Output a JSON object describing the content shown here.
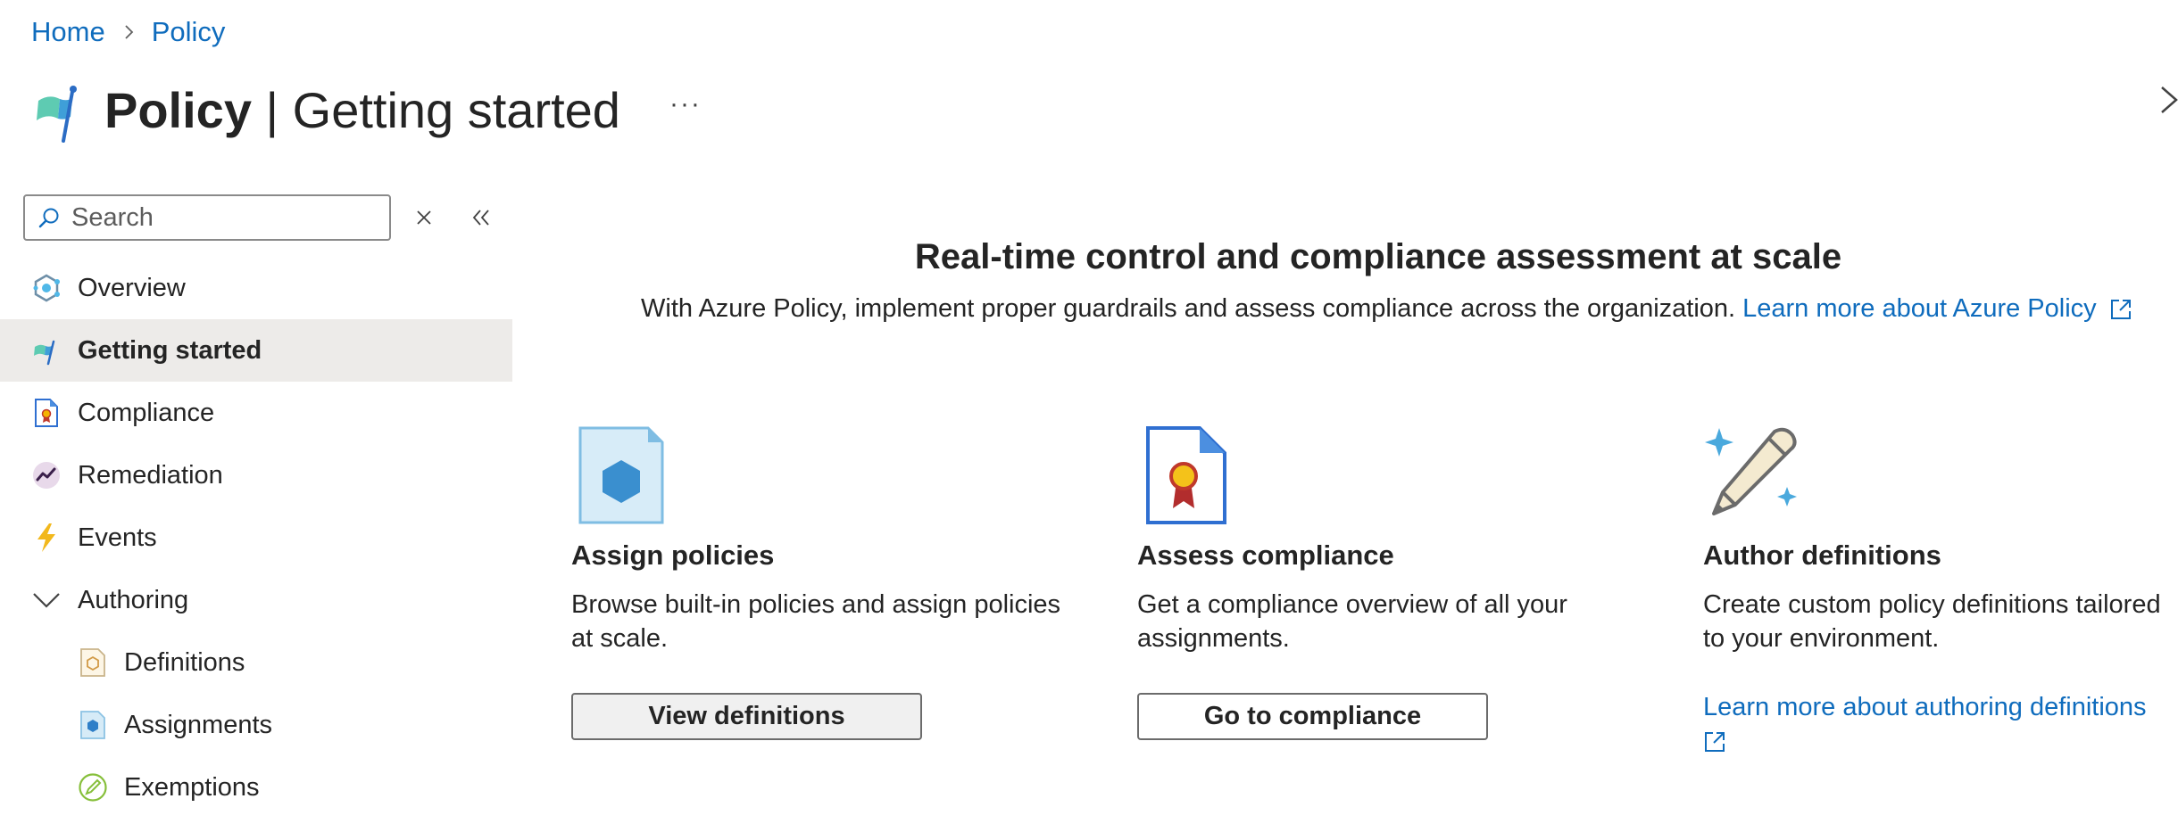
{
  "breadcrumb": {
    "home": "Home",
    "policy": "Policy"
  },
  "header": {
    "title_bold": "Policy",
    "title_separator": " | ",
    "title_rest": "Getting started",
    "more": "···"
  },
  "sidebar": {
    "search_placeholder": "Search",
    "items": [
      {
        "label": "Overview",
        "icon": "overview-icon"
      },
      {
        "label": "Getting started",
        "icon": "getting-started-icon",
        "active": true
      },
      {
        "label": "Compliance",
        "icon": "compliance-icon"
      },
      {
        "label": "Remediation",
        "icon": "remediation-icon"
      },
      {
        "label": "Events",
        "icon": "events-icon"
      },
      {
        "label": "Authoring",
        "icon": "chevron-down-icon",
        "expanded": true
      },
      {
        "label": "Definitions",
        "icon": "definitions-icon"
      },
      {
        "label": "Assignments",
        "icon": "assignments-icon"
      },
      {
        "label": "Exemptions",
        "icon": "exemptions-icon"
      }
    ]
  },
  "hero": {
    "title": "Real-time control and compliance assessment at scale",
    "subtitle": "With Azure Policy, implement proper guardrails and assess compliance across the organization.",
    "link": "Learn more about Azure Policy"
  },
  "cards": [
    {
      "title": "Assign policies",
      "description": "Browse built-in policies and assign policies at scale.",
      "button": "View definitions"
    },
    {
      "title": "Assess compliance",
      "description": "Get a compliance overview of all your assignments.",
      "button": "Go to compliance"
    },
    {
      "title": "Author definitions",
      "description": "Create custom policy definitions tailored to your environment.",
      "link": "Learn more about authoring definitions"
    }
  ],
  "colors": {
    "link": "#0f6cbd",
    "active_bg": "#edebe9",
    "text": "#242424"
  }
}
